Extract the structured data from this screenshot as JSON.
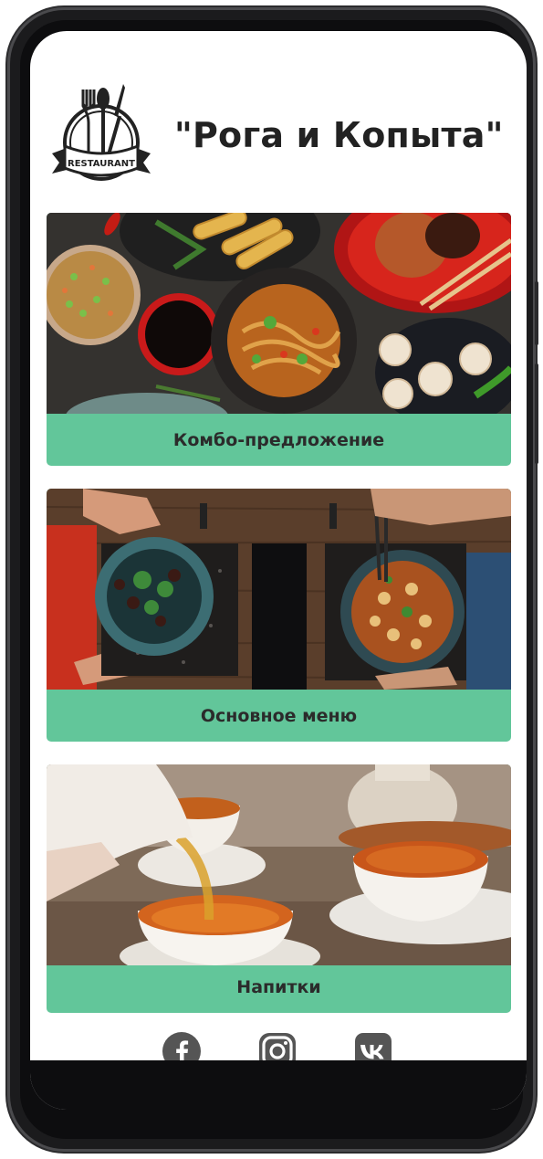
{
  "header": {
    "title": "\"Рога и Копыта\"",
    "logo_text": "RESTAURANT"
  },
  "cards": [
    {
      "label": "Комбо-предложение",
      "image": "asian-food-spread-photo"
    },
    {
      "label": "Основное меню",
      "image": "noodle-bowls-table-photo"
    },
    {
      "label": "Напитки",
      "image": "tea-pouring-photo"
    }
  ],
  "social": [
    {
      "name": "facebook-icon"
    },
    {
      "name": "instagram-icon"
    },
    {
      "name": "vk-icon"
    }
  ],
  "colors": {
    "accent": "#62c69a",
    "text": "#2b2b2b",
    "icon": "#555555"
  }
}
